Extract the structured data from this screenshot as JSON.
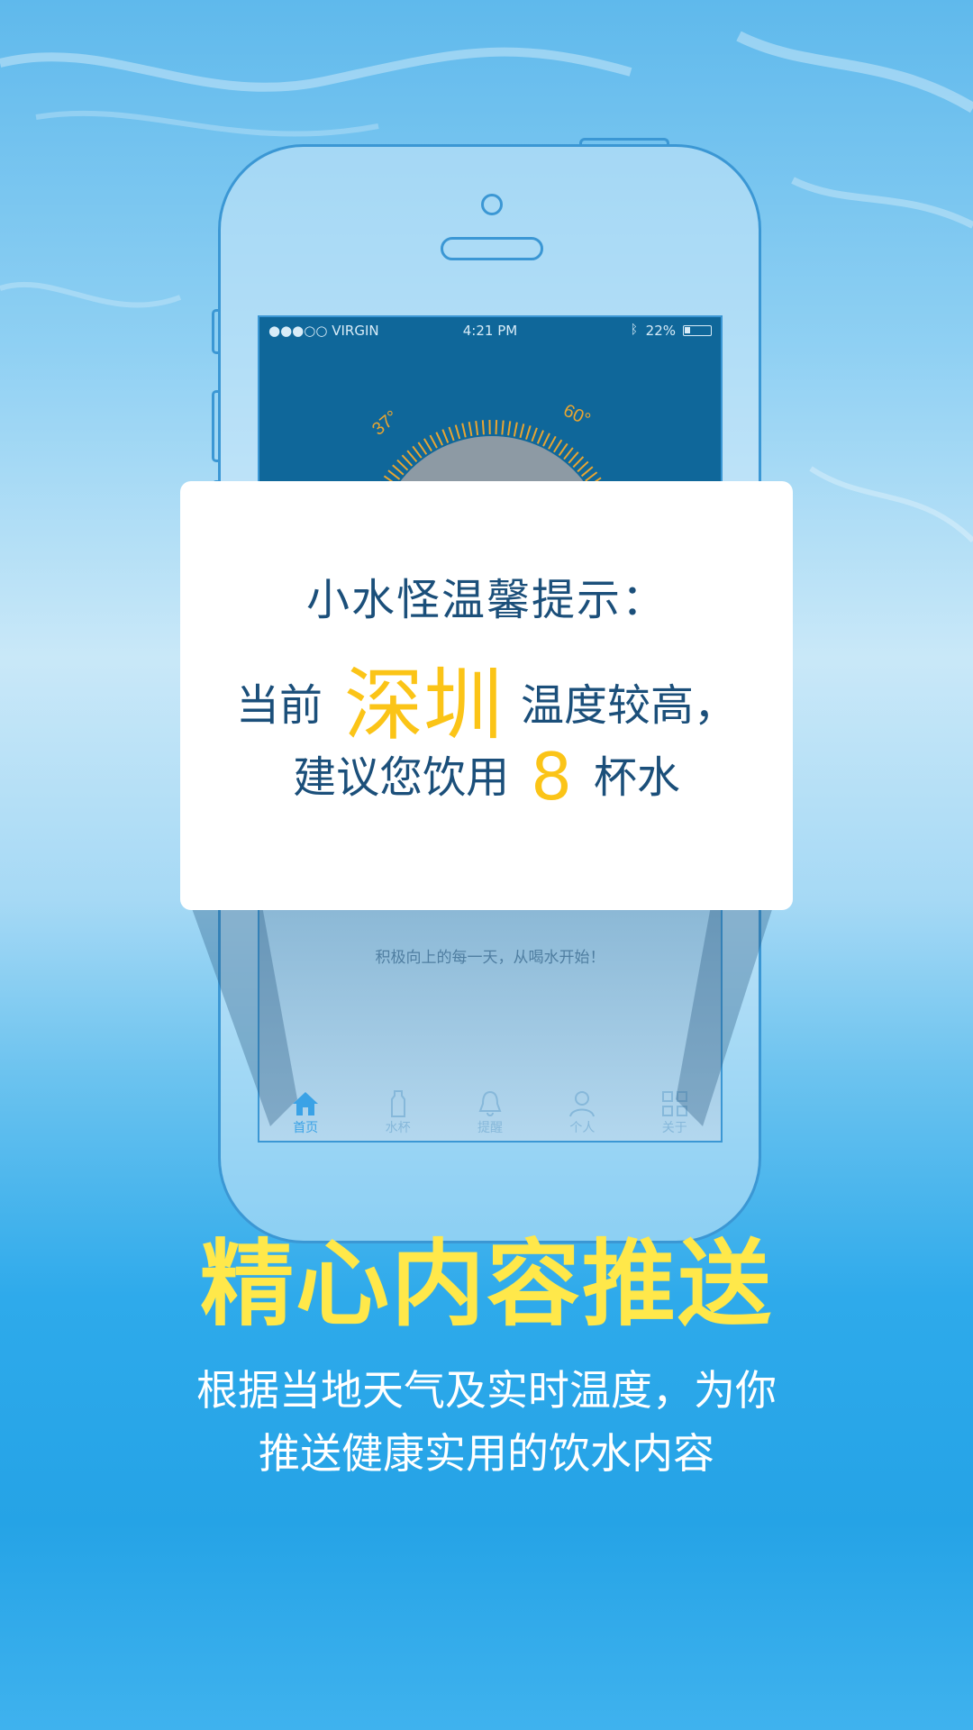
{
  "status_bar": {
    "carrier": "●●●○○ VIRGIN",
    "time": "4:21 PM",
    "battery": "22%"
  },
  "gauge": {
    "left_label": "37°",
    "right_label": "60°"
  },
  "slogan": "积极向上的每一天，从喝水开始！",
  "tabs": [
    {
      "label": "首页",
      "icon": "home-icon",
      "active": true
    },
    {
      "label": "水杯",
      "icon": "bottle-icon",
      "active": false
    },
    {
      "label": "提醒",
      "icon": "bell-icon",
      "active": false
    },
    {
      "label": "个人",
      "icon": "person-icon",
      "active": false
    },
    {
      "label": "关于",
      "icon": "grid-icon",
      "active": false
    }
  ],
  "card": {
    "title": "小水怪温馨提示：",
    "prefix": "当前",
    "city": "深圳",
    "suffix": "温度较高，",
    "advice_prefix": "建议您饮用",
    "cups": "8",
    "advice_suffix": "杯水"
  },
  "headline": "精心内容推送",
  "description": {
    "line1": "根据当地天气及实时温度，为你",
    "line2": "推送健康实用的饮水内容"
  },
  "colors": {
    "accent_yellow": "#fbc417",
    "headline_yellow": "#ffe84a",
    "text_dark_blue": "#1b4f7a",
    "screen_blue": "#0f679a"
  }
}
